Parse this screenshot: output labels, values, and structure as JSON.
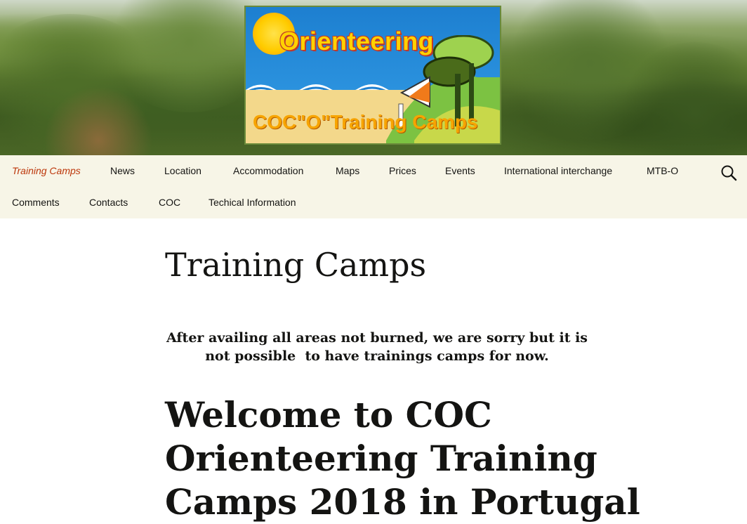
{
  "logo": {
    "title": "Orienteering",
    "subtitle": "COC\"O\"Training Camps"
  },
  "nav": {
    "row1": [
      {
        "label": "Training Camps",
        "current": true
      },
      {
        "label": "News"
      },
      {
        "label": "Location"
      },
      {
        "label": "Accommodation"
      },
      {
        "label": "Maps"
      },
      {
        "label": "Prices"
      },
      {
        "label": "Events"
      },
      {
        "label": "International interchange"
      },
      {
        "label": "MTB-O"
      }
    ],
    "row2": [
      {
        "label": "Comments"
      },
      {
        "label": "Contacts"
      },
      {
        "label": "COC"
      },
      {
        "label": "Techical Information"
      }
    ],
    "search_icon": "search-icon"
  },
  "content": {
    "page_title": "Training Camps",
    "notice_line1": "After availing all areas not burned, we are sorry but it is",
    "notice_line2": "not possible  to have trainings camps for now.",
    "welcome_line1": "Welcome to COC",
    "welcome_line2": "Orienteering Training",
    "welcome_line3": "Camps 2018 in Portugal"
  },
  "colors": {
    "nav_background": "#f7f5e7",
    "current_link": "#bc360a",
    "text": "#141412"
  }
}
